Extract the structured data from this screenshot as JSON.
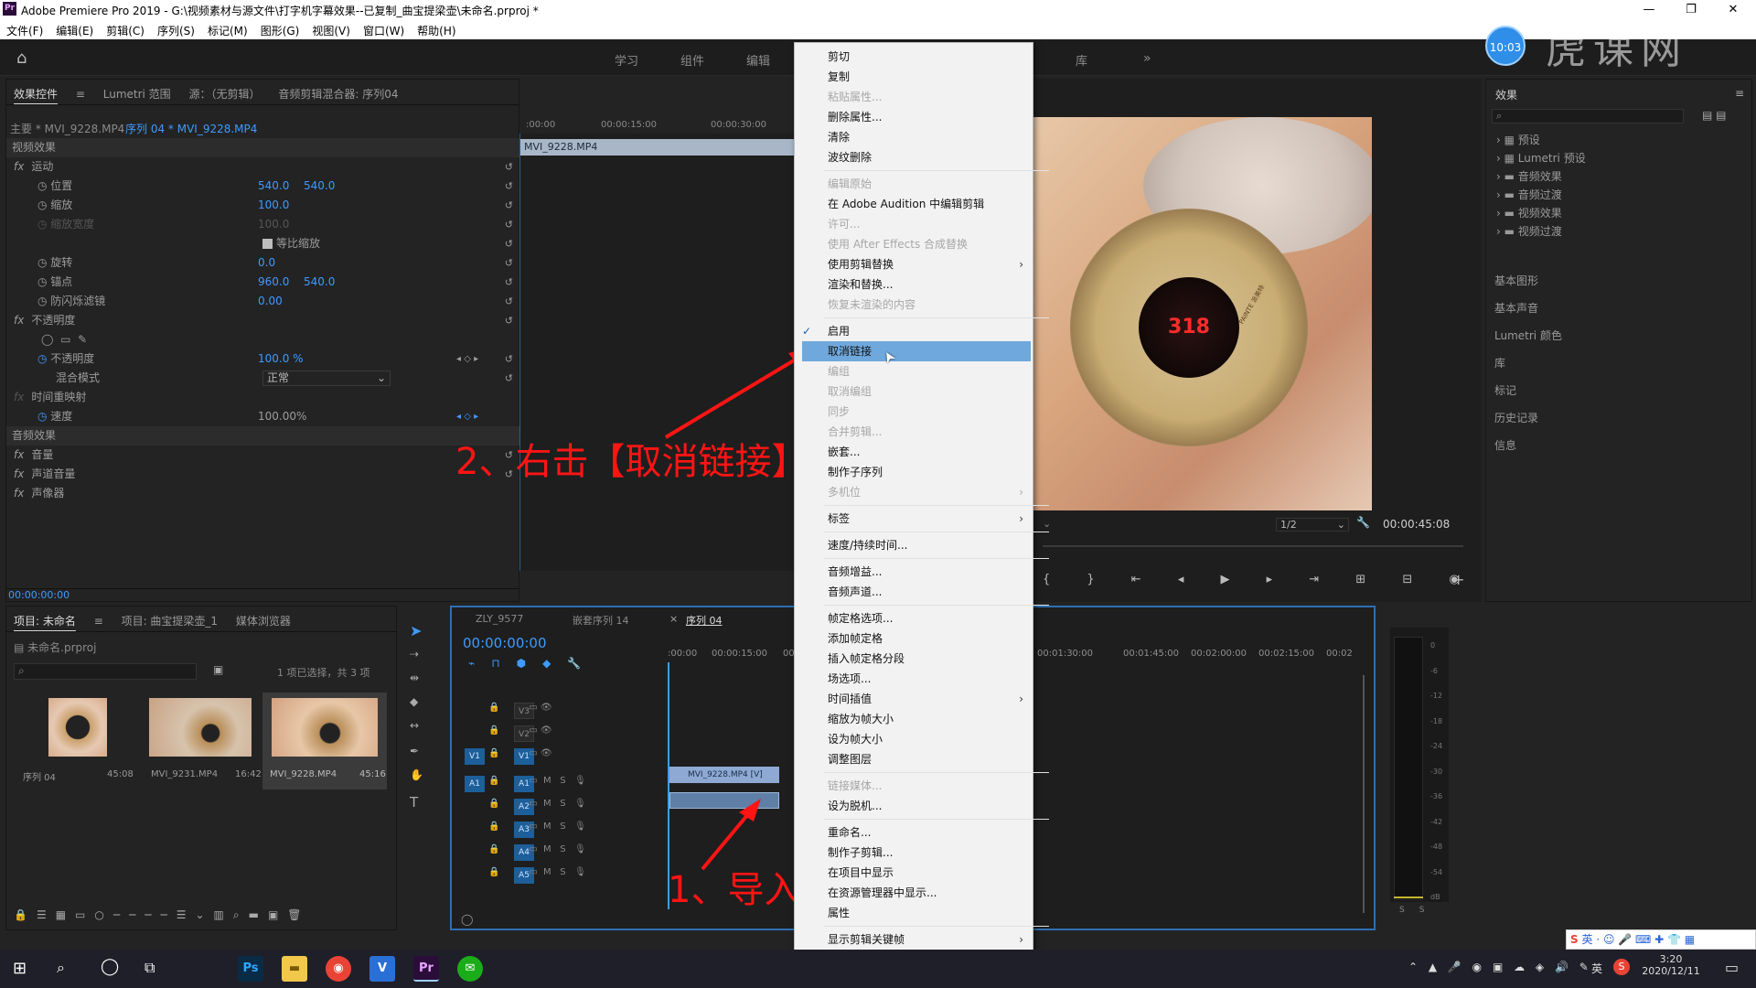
{
  "window": {
    "app_icon": "Pr",
    "title": "Adobe Premiere Pro 2019 - G:\\视频素材与源文件\\打字机字幕效果--已复制_曲宝提梁壶\\未命名.prproj *",
    "controls": [
      "—",
      "❐",
      "✕"
    ]
  },
  "menubar": [
    "文件(F)",
    "编辑(E)",
    "剪辑(C)",
    "序列(S)",
    "标记(M)",
    "图形(G)",
    "视图(V)",
    "窗口(W)",
    "帮助(H)"
  ],
  "workspaces": [
    "学习",
    "组件",
    "编辑",
    "库"
  ],
  "effect_controls": {
    "tabs": [
      "效果控件",
      "Lumetri 范围",
      "源：（无剪辑）",
      "音频剪辑混合器: 序列04"
    ],
    "master": "主要 * MVI_9228.MP4",
    "sequence_clip": "序列 04 * MVI_9228.MP4",
    "ruler_times": [
      ":00:00",
      "00:00:15:00",
      "00:00:30:00"
    ],
    "clip_name": "MVI_9228.MP4",
    "section_video": "视频效果",
    "motion": "运动",
    "position": {
      "label": "位置",
      "x": "540.0",
      "y": "540.0"
    },
    "scale": {
      "label": "缩放",
      "value": "100.0"
    },
    "scale_width": {
      "label": "缩放宽度",
      "value": "100.0"
    },
    "uniform_scale": "等比缩放",
    "rotation": {
      "label": "旋转",
      "value": "0.0"
    },
    "anchor": {
      "label": "锚点",
      "x": "960.0",
      "y": "540.0"
    },
    "antiflicker": {
      "label": "防闪烁滤镜",
      "value": "0.00"
    },
    "opacity_group": "不透明度",
    "opacity": {
      "label": "不透明度",
      "value": "100.0 %"
    },
    "blend": {
      "label": "混合模式",
      "value": "正常"
    },
    "time_remap": "时间重映射",
    "speed": {
      "label": "速度",
      "value": "100.00%"
    },
    "section_audio": "音频效果",
    "volume": "音量",
    "channel_volume": "声道音量",
    "panner": "声像器",
    "timecode": "00:00:00:00"
  },
  "annotations": {
    "step2": "2、右击【取消链接】",
    "step1": "1、导入两个视频素材"
  },
  "context_menu": {
    "items": [
      {
        "label": "剪切",
        "enabled": true
      },
      {
        "label": "复制",
        "enabled": true
      },
      {
        "label": "粘贴属性...",
        "enabled": false
      },
      {
        "label": "删除属性...",
        "enabled": true
      },
      {
        "label": "清除",
        "enabled": true
      },
      {
        "label": "波纹删除",
        "enabled": true
      },
      {
        "label": "编辑原始",
        "enabled": false
      },
      {
        "label": "在 Adobe Audition 中编辑剪辑",
        "enabled": true
      },
      {
        "label": "许可...",
        "enabled": false
      },
      {
        "label": "使用 After Effects 合成替换",
        "enabled": false
      },
      {
        "label": "使用剪辑替换",
        "enabled": true,
        "submenu": true
      },
      {
        "label": "渲染和替换...",
        "enabled": true
      },
      {
        "label": "恢复未渲染的内容",
        "enabled": false
      },
      {
        "label": "启用",
        "enabled": true,
        "checked": true
      },
      {
        "label": "取消链接",
        "enabled": true,
        "highlighted": true
      },
      {
        "label": "编组",
        "enabled": false
      },
      {
        "label": "取消编组",
        "enabled": false
      },
      {
        "label": "同步",
        "enabled": false
      },
      {
        "label": "合并剪辑...",
        "enabled": false
      },
      {
        "label": "嵌套...",
        "enabled": true
      },
      {
        "label": "制作子序列",
        "enabled": true
      },
      {
        "label": "多机位",
        "enabled": false,
        "submenu": true
      },
      {
        "label": "标签",
        "enabled": true,
        "submenu": true
      },
      {
        "label": "速度/持续时间...",
        "enabled": true
      },
      {
        "label": "音频增益...",
        "enabled": true
      },
      {
        "label": "音频声道...",
        "enabled": true
      },
      {
        "label": "帧定格选项...",
        "enabled": true
      },
      {
        "label": "添加帧定格",
        "enabled": true
      },
      {
        "label": "插入帧定格分段",
        "enabled": true
      },
      {
        "label": "场选项...",
        "enabled": true
      },
      {
        "label": "时间插值",
        "enabled": true,
        "submenu": true
      },
      {
        "label": "缩放为帧大小",
        "enabled": true
      },
      {
        "label": "设为帧大小",
        "enabled": true
      },
      {
        "label": "调整图层",
        "enabled": true
      },
      {
        "label": "链接媒体...",
        "enabled": false
      },
      {
        "label": "设为脱机...",
        "enabled": true
      },
      {
        "label": "重命名...",
        "enabled": true
      },
      {
        "label": "制作子剪辑...",
        "enabled": true
      },
      {
        "label": "在项目中显示",
        "enabled": true
      },
      {
        "label": "在资源管理器中显示...",
        "enabled": true
      },
      {
        "label": "属性",
        "enabled": true
      },
      {
        "label": "显示剪辑关键帧",
        "enabled": true,
        "submenu": true
      }
    ]
  },
  "program_monitor": {
    "page": "1/2",
    "timecode": "00:00:45:08",
    "badge_time": "10:03",
    "watermark": "虎课网",
    "device_brand": "PAINTE 派美特"
  },
  "effects_panel": {
    "title": "效果",
    "folders": [
      "预设",
      "Lumetri 预设",
      "音频效果",
      "音频过渡",
      "视频效果",
      "视频过渡"
    ],
    "sections": [
      "基本图形",
      "基本声音",
      "Lumetri 颜色",
      "库",
      "标记",
      "历史记录",
      "信息"
    ]
  },
  "project": {
    "tabs": [
      "项目: 未命名",
      "项目: 曲宝提梁壶_1",
      "媒体浏览器"
    ],
    "file": "未命名.prproj",
    "selection": "1 项已选择，共 3 项",
    "items": [
      {
        "name": "序列 04",
        "dur": "45:08"
      },
      {
        "name": "MVI_9231.MP4",
        "dur": "16:42"
      },
      {
        "name": "MVI_9228.MP4",
        "dur": "45:16"
      }
    ]
  },
  "timeline": {
    "tabs": [
      "ZLY_9577",
      "嵌套序列 14",
      "序列 04"
    ],
    "timecode": "00:00:00:00",
    "ruler": [
      ":00:00",
      "00:00:15:00",
      "00:00:30:00",
      "00:01:30:00",
      "00:01:45:00",
      "00:02:00:00",
      "00:02:15:00",
      "00:02"
    ],
    "video_tracks": [
      "V3",
      "V2",
      "V1"
    ],
    "audio_tracks": [
      "A1",
      "A2",
      "A3",
      "A4",
      "A5"
    ],
    "clip_v": "MVI_9228.MP4 [V]",
    "meter_labels": [
      "0",
      "-6",
      "-12",
      "-18",
      "-24",
      "-30",
      "-36",
      "-42",
      "-48",
      "-54",
      "dB"
    ]
  },
  "taskbar": {
    "ime": "英",
    "time": "3:20",
    "date": "2020/12/11",
    "lang": "英"
  }
}
